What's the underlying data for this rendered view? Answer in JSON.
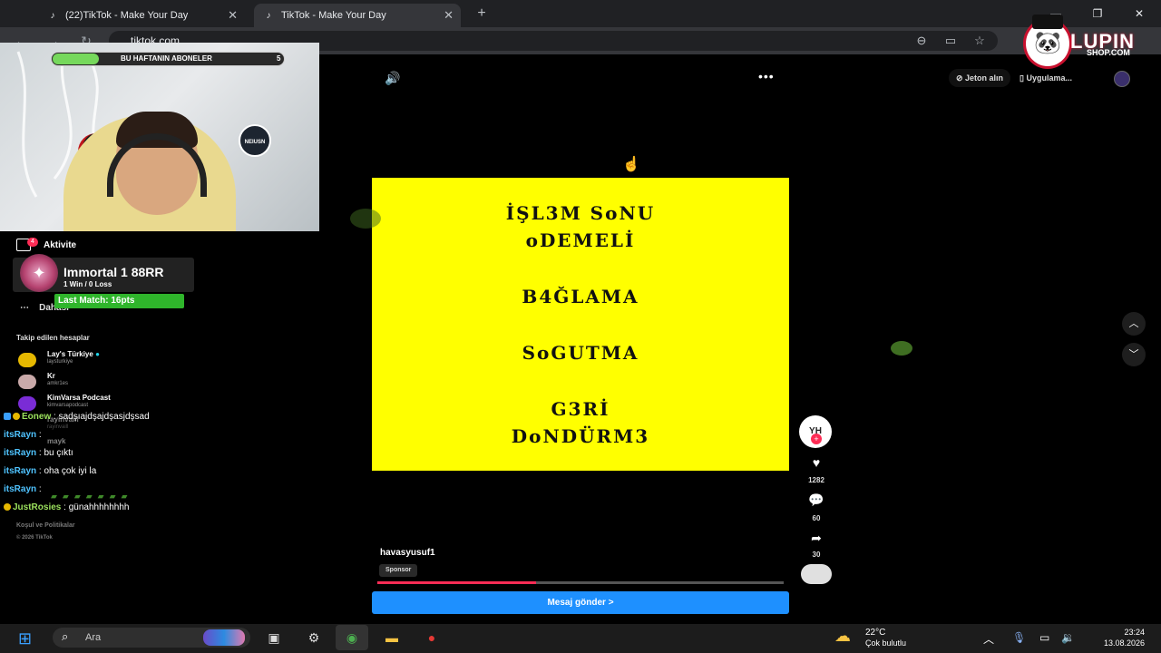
{
  "browser": {
    "tabs": [
      {
        "label": "(22)TikTok - Make Your Day"
      },
      {
        "label": "TikTok - Make Your Day"
      }
    ],
    "url": "tiktok.com"
  },
  "stream_overlay": {
    "subscribers_label": "BU HAFTANIN ABONELER",
    "subscribers_count": "5",
    "subscribers_progress": 0.2,
    "channel_logo": "NEIUSN",
    "rank_title": "Immortal 1  88RR",
    "rank_record": "1 Win / 0 Loss",
    "last_match": "Last Match: 16pts",
    "brand_name": "LUPIN",
    "brand_sub": "SHOP.COM"
  },
  "sidebar": {
    "activity_label": "Aktivite",
    "activity_badge": "4",
    "more_label": "Dahası",
    "following_title": "Takip edilen hesaplar",
    "accounts": [
      {
        "name": "Lay's Türkiye",
        "handle": "laysturkiye"
      },
      {
        "name": "Kr",
        "handle": "amkr1es"
      },
      {
        "name": "KimVarsa Podcast",
        "handle": "kimvarsapodcast"
      },
      {
        "name": "rayinvaill",
        "handle": "rayinvaill"
      },
      {
        "name": "mayk",
        "handle": ""
      }
    ],
    "footer_link": "Koşul ve Politikalar",
    "copyright": "© 2026 TikTok"
  },
  "chat": [
    {
      "user": "Eonew",
      "message": ": sadşıajdşajdşasjdşsad"
    },
    {
      "user": "itsRayn",
      "message": ":"
    },
    {
      "user": "itsRayn",
      "message": ": bu çıktı"
    },
    {
      "user": "itsRayn",
      "message": ": oha çok iyi la"
    },
    {
      "user": "itsRayn",
      "message": ":"
    },
    {
      "user": "JustRosies",
      "message": ": günahhhhhhhh"
    }
  ],
  "topbar": {
    "coins_label": "Jeton alın",
    "apps_label": "Uygulama..."
  },
  "video": {
    "lines": [
      "İŞL3M SoNU",
      "oDEMELİ",
      "B4ĞLAMA",
      "SoGUTMA",
      "G3Rİ",
      "DoNDÜRM3"
    ],
    "author": "havasyusuf1",
    "sponsor_label": "Sponsor",
    "progress": 0.39,
    "cta_label": "Mesaj gönder  >",
    "avatar_text": "YH",
    "likes": "1282",
    "comments": "60",
    "shares": "30"
  },
  "taskbar": {
    "search_placeholder": "Ara",
    "temperature": "22°C",
    "weather": "Çok bulutlu",
    "time": "23:24",
    "date": "13.08.2026"
  }
}
